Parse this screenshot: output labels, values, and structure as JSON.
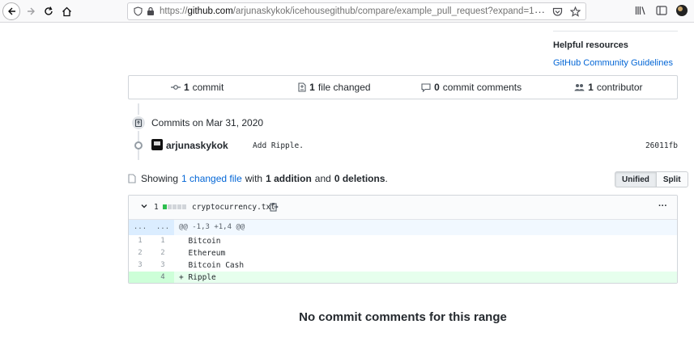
{
  "browser": {
    "url_prefix": "https://",
    "url_domain": "github.com",
    "url_path": "/arjunaskykok/icehousegithub/compare/example_pull_request?expand=1",
    "url_menu": "···"
  },
  "sidebar": {
    "heading": "Helpful resources",
    "link": "GitHub Community Guidelines"
  },
  "summary": {
    "commits_count": "1",
    "commits_label": "commit",
    "files_count": "1",
    "files_label": "file changed",
    "comments_count": "0",
    "comments_label": "commit comments",
    "contributors_count": "1",
    "contributors_label": "contributor"
  },
  "commits": {
    "date_heading": "Commits on Mar 31, 2020",
    "items": [
      {
        "author": "arjunaskykok",
        "message": "Add Ripple.",
        "sha": "26011fb"
      }
    ]
  },
  "showing": {
    "prefix": "Showing",
    "changed_files": "1 changed file",
    "with": "with",
    "additions": "1 addition",
    "and": "and",
    "deletions": "0 deletions",
    "period": ".",
    "unified": "Unified",
    "split": "Split"
  },
  "diff": {
    "expand_icon": "chevron-down",
    "count": "1",
    "filename": "cryptocurrency.txt",
    "more": "···",
    "hunk_left": "...",
    "hunk_right": "...",
    "hunk_header": "@@ -1,3 +1,4 @@",
    "lines": [
      {
        "old": "1",
        "new": "1",
        "text": "  Bitcoin"
      },
      {
        "old": "2",
        "new": "2",
        "text": "  Ethereum"
      },
      {
        "old": "3",
        "new": "3",
        "text": "  Bitcoin Cash"
      },
      {
        "old": "",
        "new": "4",
        "text": "+ Ripple"
      }
    ]
  },
  "footer": {
    "no_comments": "No commit comments for this range"
  },
  "colors": {
    "link": "#0366d6",
    "added_bg": "#e6ffed",
    "hunk_bg": "#f1f8ff"
  }
}
